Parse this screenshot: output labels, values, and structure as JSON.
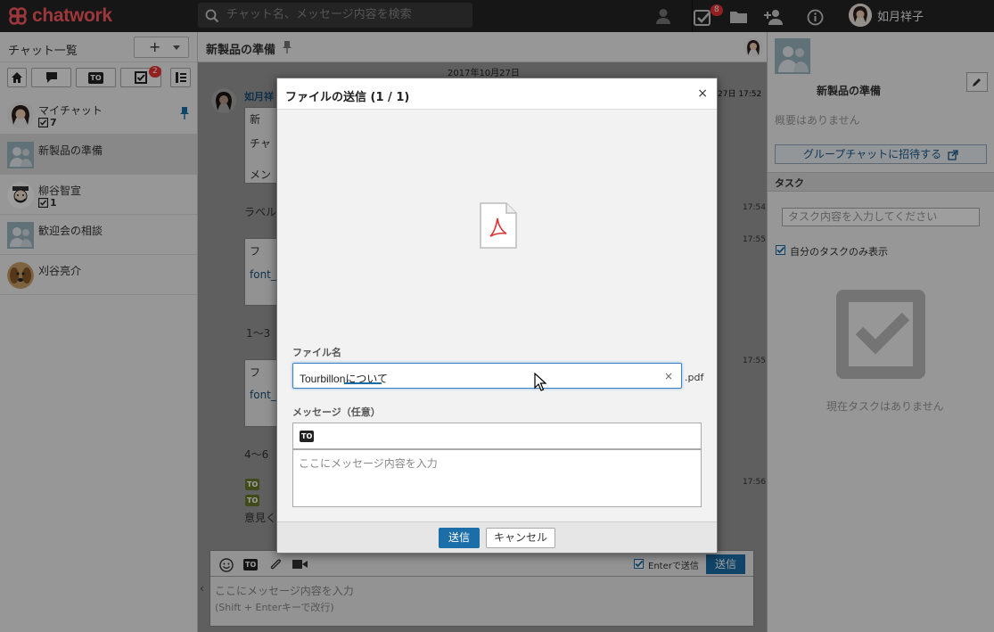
{
  "app": {
    "brand": "chatwork",
    "accent": "#1b6ea8",
    "logo_color": "#ff5a5f"
  },
  "topbar": {
    "search_placeholder": "チャット名、メッセージ内容を検索",
    "task_badge": "8",
    "user_name": "如月祥子"
  },
  "sidebar": {
    "title": "チャット一覧",
    "add_label": "+",
    "filter_badge": "2",
    "rooms": [
      {
        "name": "マイチャット",
        "task_count": "7",
        "active": false,
        "pinned": true
      },
      {
        "name": "新製品の準備",
        "task_count": "",
        "active": true,
        "pinned": false
      },
      {
        "name": "柳谷智宣",
        "task_count": "1",
        "active": false,
        "pinned": false
      },
      {
        "name": "歓迎会の相談",
        "task_count": "",
        "active": false,
        "pinned": false
      },
      {
        "name": "刈谷亮介",
        "task_count": "",
        "active": false,
        "pinned": false
      }
    ]
  },
  "chat": {
    "title": "新製品の準備",
    "date": "2017年10月27日",
    "sender": "如月祥",
    "times": [
      "27日 17:52",
      "17:54",
      "17:55",
      "17:55",
      "17:56"
    ],
    "fragments": {
      "q1_title": "新",
      "q1_l1": "チャ",
      "q1_l2": "メン",
      "m2": "ラベル",
      "q2_title": "フ",
      "q2_link": "font_",
      "m3": "1〜3",
      "q3_title": "フ",
      "q3_link": "font_",
      "m4": "4〜6",
      "m5": "意見く"
    },
    "composer": {
      "placeholder": "ここにメッセージ内容を入力",
      "hint": "(Shift + Enterキーで改行)",
      "enter_label": "Enterで送信",
      "send_label": "送信",
      "enter_checked": true
    }
  },
  "right": {
    "room_name": "新製品の準備",
    "no_summary": "概要はありません",
    "invite_label": "グループチャットに招待する",
    "task_header": "タスク",
    "task_placeholder": "タスク内容を入力してください",
    "own_only_label": "自分のタスクのみ表示",
    "no_tasks": "現在タスクはありません"
  },
  "modal": {
    "title": "ファイルの送信 (1 / 1)",
    "close": "×",
    "filename_label": "ファイル名",
    "filename_value": "Tourbillonについて",
    "extension": ".pdf",
    "message_label": "メッセージ（任意）",
    "to_chip": "TO",
    "message_placeholder": "ここにメッセージ内容を入力",
    "send_label": "送信",
    "cancel_label": "キャンセル"
  }
}
